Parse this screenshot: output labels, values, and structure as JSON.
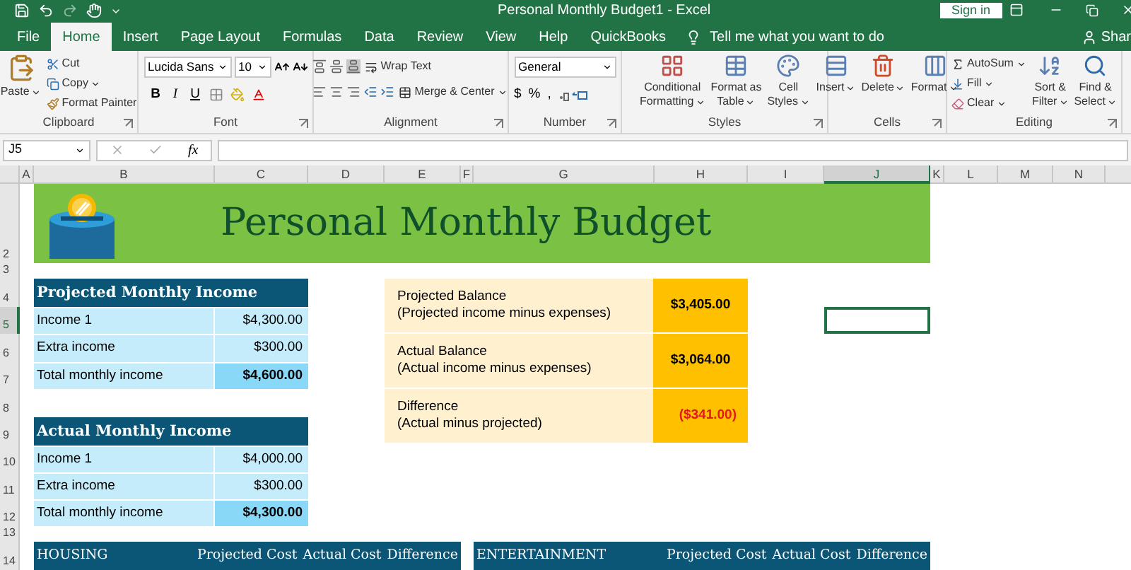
{
  "window": {
    "title": "Personal Monthly Budget1  -  Excel",
    "sign_in": "Sign in"
  },
  "tabs": [
    {
      "label": "File",
      "selected": false
    },
    {
      "label": "Home",
      "selected": true
    },
    {
      "label": "Insert",
      "selected": false
    },
    {
      "label": "Page Layout",
      "selected": false
    },
    {
      "label": "Formulas",
      "selected": false
    },
    {
      "label": "Data",
      "selected": false
    },
    {
      "label": "Review",
      "selected": false
    },
    {
      "label": "View",
      "selected": false
    },
    {
      "label": "Help",
      "selected": false
    },
    {
      "label": "QuickBooks",
      "selected": false
    }
  ],
  "tell_me": "Tell me what you want to do",
  "share": "Shar",
  "ribbon": {
    "clipboard": {
      "label": "Clipboard",
      "paste": "Paste",
      "cut": "Cut",
      "copy": "Copy",
      "format_painter": "Format Painter"
    },
    "font": {
      "label": "Font",
      "font_name": "Lucida Sans",
      "font_size": "10",
      "bold": "B",
      "italic": "I",
      "underline": "U"
    },
    "alignment": {
      "label": "Alignment",
      "wrap_text": "Wrap Text",
      "merge": "Merge & Center"
    },
    "number": {
      "label": "Number",
      "format": "General",
      "currency": "$",
      "percent": "%",
      "comma": ","
    },
    "styles": {
      "label": "Styles",
      "buttons": [
        [
          "Conditional",
          "Formatting"
        ],
        [
          "Format as",
          "Table"
        ],
        [
          "Cell",
          "Styles"
        ]
      ]
    },
    "cells": {
      "label": "Cells",
      "buttons": [
        "Insert",
        "Delete",
        "Format"
      ]
    },
    "editing": {
      "label": "Editing",
      "autosum": "AutoSum",
      "fill": "Fill",
      "clear": "Clear",
      "buttons": [
        [
          "Sort &",
          "Filter"
        ],
        [
          "Find &",
          "Select"
        ]
      ]
    }
  },
  "formula_bar": {
    "name_box": "J5",
    "fx": "fx"
  },
  "columns": [
    {
      "label": "A",
      "selected": false
    },
    {
      "label": "B",
      "selected": false
    },
    {
      "label": "C",
      "selected": false
    },
    {
      "label": "D",
      "selected": false
    },
    {
      "label": "E",
      "selected": false
    },
    {
      "label": "F",
      "selected": false
    },
    {
      "label": "G",
      "selected": false
    },
    {
      "label": "H",
      "selected": false
    },
    {
      "label": "I",
      "selected": false
    },
    {
      "label": "J",
      "selected": true
    },
    {
      "label": "K",
      "selected": false
    },
    {
      "label": "L",
      "selected": false
    },
    {
      "label": "M",
      "selected": false
    },
    {
      "label": "N",
      "selected": false
    }
  ],
  "rows": [
    {
      "label": "2",
      "selected": false
    },
    {
      "label": "3",
      "selected": false
    },
    {
      "label": "4",
      "selected": false
    },
    {
      "label": "5",
      "selected": true
    },
    {
      "label": "6",
      "selected": false
    },
    {
      "label": "7",
      "selected": false
    },
    {
      "label": "8",
      "selected": false
    },
    {
      "label": "9",
      "selected": false
    },
    {
      "label": "10",
      "selected": false
    },
    {
      "label": "11",
      "selected": false
    },
    {
      "label": "12",
      "selected": false
    },
    {
      "label": "13",
      "selected": false
    },
    {
      "label": "14",
      "selected": false
    }
  ],
  "sheet": {
    "title": "Personal Monthly Budget",
    "income_tables": [
      {
        "title": "Projected Monthly Income",
        "rows": [
          {
            "label": "Income 1",
            "value": "$4,300.00",
            "kind": "item"
          },
          {
            "label": "Extra income",
            "value": "$300.00",
            "kind": "item"
          },
          {
            "label": "Total monthly income",
            "value": "$4,600.00",
            "kind": "total"
          }
        ]
      },
      {
        "title": "Actual Monthly Income",
        "rows": [
          {
            "label": "Income 1",
            "value": "$4,000.00",
            "kind": "item"
          },
          {
            "label": "Extra income",
            "value": "$300.00",
            "kind": "item"
          },
          {
            "label": "Total monthly income",
            "value": "$4,300.00",
            "kind": "total"
          }
        ]
      }
    ],
    "balances": [
      {
        "label": "Projected Balance",
        "note": "(Projected income minus expenses)",
        "value": "$3,405.00",
        "negative": false
      },
      {
        "label": "Actual Balance",
        "note": "(Actual income minus expenses)",
        "value": "$3,064.00",
        "negative": false
      },
      {
        "label": "Difference",
        "note": "(Actual minus projected)",
        "value": "($341.00)",
        "negative": true
      }
    ],
    "expense_headers": [
      {
        "title": "HOUSING",
        "columns": [
          "Projected Cost",
          "Actual Cost",
          "Difference"
        ]
      },
      {
        "title": "ENTERTAINMENT",
        "columns": [
          "Projected Cost",
          "Actual Cost",
          "Difference"
        ]
      }
    ]
  }
}
